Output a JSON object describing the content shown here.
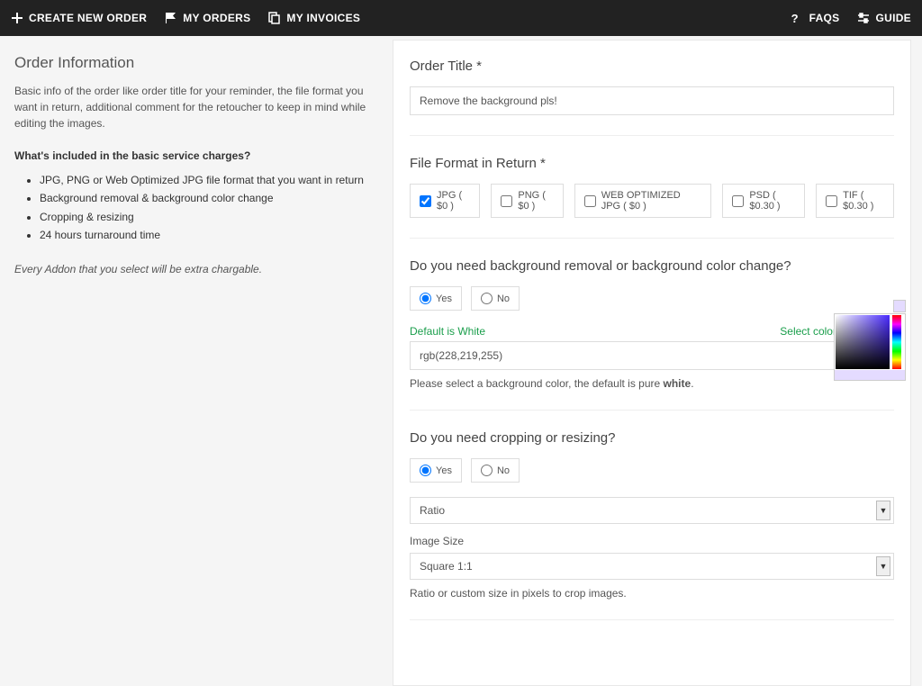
{
  "topbar": {
    "create": "CREATE NEW ORDER",
    "orders": "MY ORDERS",
    "invoices": "MY INVOICES",
    "faqs": "FAQS",
    "guide": "GUIDE"
  },
  "sidebar": {
    "title": "Order Information",
    "desc": "Basic info of the order like order title for your reminder, the file format you want in return, additional comment for the retoucher to keep in mind while editing the images.",
    "q": "What's included in the basic service charges?",
    "items": [
      "JPG, PNG or Web Optimized JPG file format that you want in return",
      "Background removal & background color change",
      "Cropping & resizing",
      "24 hours turnaround time"
    ],
    "note": "Every Addon that you select will be extra chargable."
  },
  "orderTitle": {
    "label": "Order Title *",
    "value": "Remove the background pls!"
  },
  "fileFormat": {
    "label": "File Format in Return *",
    "options": [
      {
        "label": "JPG ( $0 )",
        "checked": true
      },
      {
        "label": "PNG ( $0 )",
        "checked": false
      },
      {
        "label": "WEB OPTIMIZED JPG ( $0 )",
        "checked": false
      },
      {
        "label": "PSD ( $0.30 )",
        "checked": false
      },
      {
        "label": "TIF ( $0.30 )",
        "checked": false
      }
    ]
  },
  "bgRemoval": {
    "label": "Do you need background removal or background color change?",
    "yes": "Yes",
    "no": "No",
    "defaultWhite": "Default is White",
    "selectColor": "Select color from here",
    "colorValue": "rgb(228,219,255)",
    "helpPrefix": "Please select a background color, the default is pure ",
    "helpBold": "white"
  },
  "cropping": {
    "label": "Do you need cropping or resizing?",
    "yes": "Yes",
    "no": "No",
    "ratioSelect": "Ratio",
    "sizeLabel": "Image Size",
    "sizeSelect": "Square 1:1",
    "help": "Ratio or custom size in pixels to crop images."
  }
}
